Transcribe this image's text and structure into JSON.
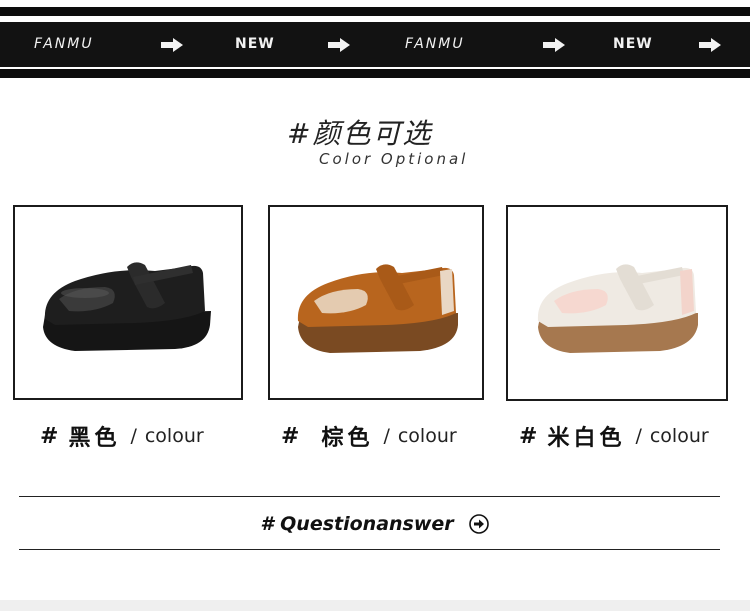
{
  "banner": {
    "brand": "FANMU",
    "new_label": "NEW"
  },
  "heading": {
    "title": "#颜色可选",
    "subtitle": "Color Optional"
  },
  "colors_section": {
    "items": [
      {
        "hash": "#",
        "name": "黑色",
        "slash": "/",
        "word": "colour",
        "shoe_color": "#111111"
      },
      {
        "hash": "#",
        "name": "棕色",
        "slash": "/",
        "word": "colour",
        "shoe_color": "#b8651e"
      },
      {
        "hash": "#",
        "name": "米白色",
        "slash": "/",
        "word": "colour",
        "shoe_color": "#efeae3"
      }
    ]
  },
  "qa": {
    "label": "# Questionanswer",
    "icon": "arrow-right-circle-icon"
  }
}
